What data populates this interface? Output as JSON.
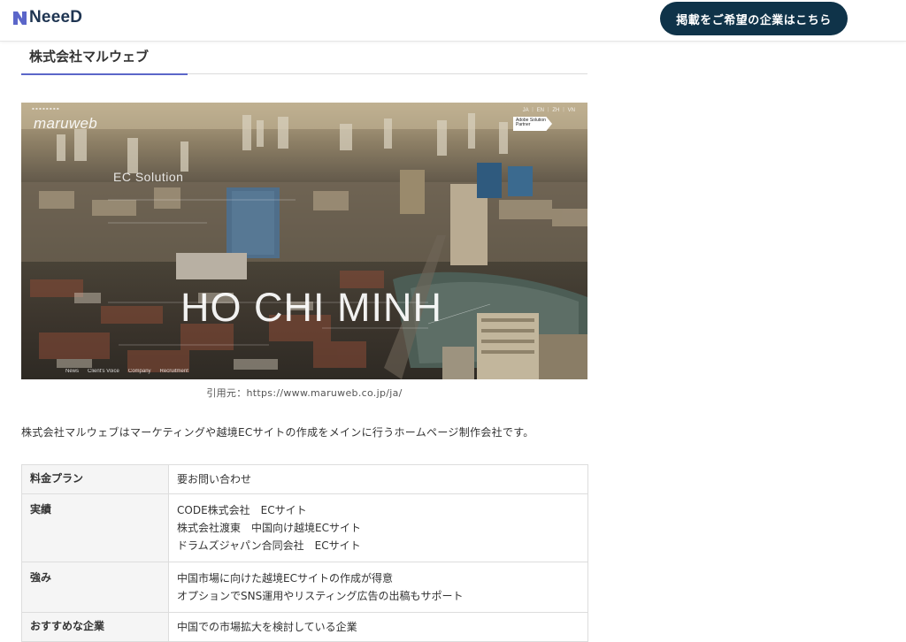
{
  "header": {
    "logo_text": "NeeeD",
    "cta_label": "掲載をご希望の企業はこちら"
  },
  "company": {
    "title": "株式会社マルウェブ"
  },
  "hero": {
    "brand": "maruweb",
    "solution": "EC Solution",
    "city": "HO CHI MINH",
    "lang": "JA ｜ EN ｜ ZH ｜ VN",
    "badge": "Adobe Solution Partner",
    "nav": [
      "News",
      "Client's Voice",
      "Company",
      "Recruitment"
    ]
  },
  "caption": "引用元：https://www.maruweb.co.jp/ja/",
  "intro": "株式会社マルウェブはマーケティングや越境ECサイトの作成をメインに行うホームページ制作会社です。",
  "table": {
    "rows": [
      {
        "label": "料金プラン",
        "lines": [
          "要お問い合わせ"
        ]
      },
      {
        "label": "実績",
        "lines": [
          "CODE株式会社　ECサイト",
          "株式会社渡東　中国向け越境ECサイト",
          "ドラムズジャパン合同会社　ECサイト"
        ]
      },
      {
        "label": "強み",
        "lines": [
          "中国市場に向けた越境ECサイトの作成が得意",
          "オプションでSNS運用やリスティング広告の出稿もサポート"
        ]
      },
      {
        "label": "おすすめな企業",
        "lines": [
          "中国での市場拡大を検討している企業"
        ]
      }
    ]
  },
  "colors": {
    "cta_bg": "#0f3349",
    "heading_accent": "#5b66c9",
    "logo": "#1f3552"
  }
}
